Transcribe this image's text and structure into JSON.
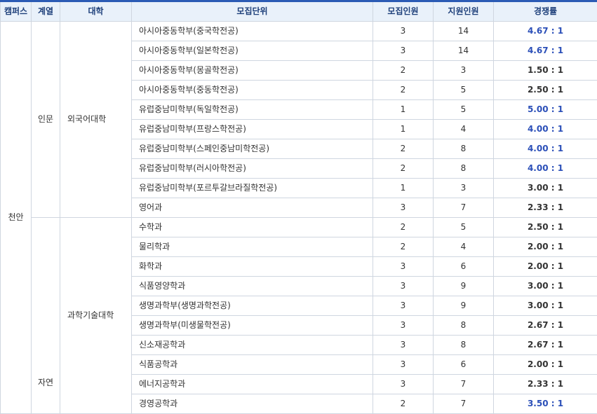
{
  "headers": [
    "캠퍼스",
    "계열",
    "대학",
    "모집단위",
    "모집인원",
    "지원인원",
    "경쟁률"
  ],
  "campus": "천안",
  "fields": {
    "humanities": "인문",
    "science": "자연"
  },
  "colleges": {
    "foreign": "외국어대학",
    "science": "과학기술대학"
  },
  "rows": [
    {
      "unit": "아시아중동학부(중국학전공)",
      "quota": "3",
      "applicants": "14",
      "rate": "4.67 : 1",
      "highlight": true
    },
    {
      "unit": "아시아중동학부(일본학전공)",
      "quota": "3",
      "applicants": "14",
      "rate": "4.67 : 1",
      "highlight": true
    },
    {
      "unit": "아시아중동학부(몽골학전공)",
      "quota": "2",
      "applicants": "3",
      "rate": "1.50 : 1",
      "highlight": false
    },
    {
      "unit": "아시아중동학부(중동학전공)",
      "quota": "2",
      "applicants": "5",
      "rate": "2.50 : 1",
      "highlight": false
    },
    {
      "unit": "유럽중남미학부(독일학전공)",
      "quota": "1",
      "applicants": "5",
      "rate": "5.00 : 1",
      "highlight": true
    },
    {
      "unit": "유럽중남미학부(프랑스학전공)",
      "quota": "1",
      "applicants": "4",
      "rate": "4.00 : 1",
      "highlight": true
    },
    {
      "unit": "유럽중남미학부(스페인중남미학전공)",
      "quota": "2",
      "applicants": "8",
      "rate": "4.00 : 1",
      "highlight": true
    },
    {
      "unit": "유럽중남미학부(러시아학전공)",
      "quota": "2",
      "applicants": "8",
      "rate": "4.00 : 1",
      "highlight": true
    },
    {
      "unit": "유럽중남미학부(포르투갈브라질학전공)",
      "quota": "1",
      "applicants": "3",
      "rate": "3.00 : 1",
      "highlight": false
    },
    {
      "unit": "영어과",
      "quota": "3",
      "applicants": "7",
      "rate": "2.33 : 1",
      "highlight": false
    },
    {
      "unit": "수학과",
      "quota": "2",
      "applicants": "5",
      "rate": "2.50 : 1",
      "highlight": false
    },
    {
      "unit": "물리학과",
      "quota": "2",
      "applicants": "4",
      "rate": "2.00 : 1",
      "highlight": false
    },
    {
      "unit": "화학과",
      "quota": "3",
      "applicants": "6",
      "rate": "2.00 : 1",
      "highlight": false
    },
    {
      "unit": "식품영양학과",
      "quota": "3",
      "applicants": "9",
      "rate": "3.00 : 1",
      "highlight": false
    },
    {
      "unit": "생명과학부(생명과학전공)",
      "quota": "3",
      "applicants": "9",
      "rate": "3.00 : 1",
      "highlight": false
    },
    {
      "unit": "생명과학부(미생물학전공)",
      "quota": "3",
      "applicants": "8",
      "rate": "2.67 : 1",
      "highlight": false
    },
    {
      "unit": "신소재공학과",
      "quota": "3",
      "applicants": "8",
      "rate": "2.67 : 1",
      "highlight": false
    },
    {
      "unit": "식품공학과",
      "quota": "3",
      "applicants": "6",
      "rate": "2.00 : 1",
      "highlight": false
    },
    {
      "unit": "에너지공학과",
      "quota": "3",
      "applicants": "7",
      "rate": "2.33 : 1",
      "highlight": false
    },
    {
      "unit": "경영공학과",
      "quota": "2",
      "applicants": "7",
      "rate": "3.50 : 1",
      "highlight": true
    }
  ],
  "colors": {
    "accent": "#2b5bb5",
    "header_bg": "#e9f1fa",
    "highlight_rate": "#2b4fb8",
    "border": "#cfd6e0"
  }
}
